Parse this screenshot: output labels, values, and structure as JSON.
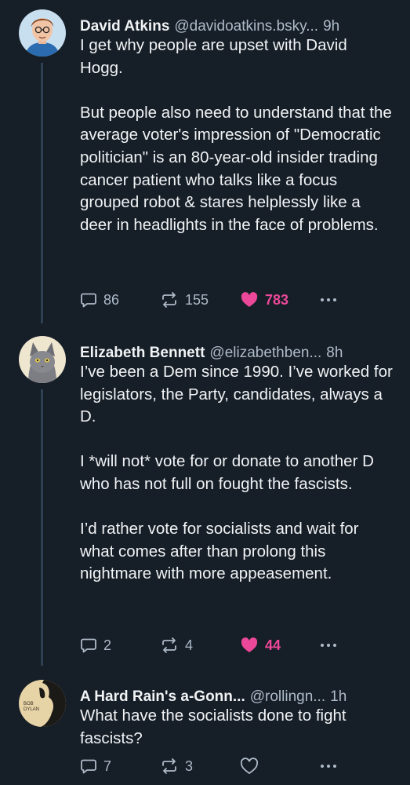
{
  "posts": [
    {
      "display_name": "David Atkins",
      "handle": "@davidoatkins.bsky...",
      "time": "9h",
      "avatar": "cartoon-man-avatar",
      "paragraphs": [
        "I get why people are upset with David Hogg.",
        "But people also need to understand that the average voter's impression of \"Democratic politician\" is an 80-year-old insider trading cancer patient who talks like a focus grouped robot & stares helplessly like a deer in headlights in the face of problems."
      ],
      "replies": "86",
      "reposts": "155",
      "likes": "783",
      "liked": true
    },
    {
      "display_name": "Elizabeth Bennett",
      "handle": "@elizabethben...",
      "time": "8h",
      "avatar": "cat-avatar",
      "paragraphs": [
        "I’ve been a Dem since 1990. I’ve worked for legislators, the Party, candidates, always a D.",
        "I *will not* vote for or donate to another D who has not full on fought the fascists.",
        "I’d rather vote for socialists and wait for what comes after than prolong this nightmare with more appeasement."
      ],
      "replies": "2",
      "reposts": "4",
      "likes": "44",
      "liked": true
    },
    {
      "display_name": "A Hard Rain's a-Gonn...",
      "handle": "@rollingn...",
      "time": "1h",
      "avatar": "bob-dylan-album-avatar",
      "avatar_text": [
        "BOB",
        "DYLAN"
      ],
      "paragraphs": [
        "What have the socialists done to fight fascists?"
      ],
      "replies": "7",
      "reposts": "3",
      "likes": "",
      "liked": false
    }
  ],
  "colors": {
    "background": "#161e27",
    "text": "#f1f3f5",
    "muted": "#aebbc9",
    "thread_line": "#2e4052",
    "like_active": "#ec4899"
  },
  "icons": {
    "reply": "speech-bubble-icon",
    "repost": "repost-arrows-icon",
    "like": "heart-icon",
    "more": "ellipsis-icon"
  }
}
